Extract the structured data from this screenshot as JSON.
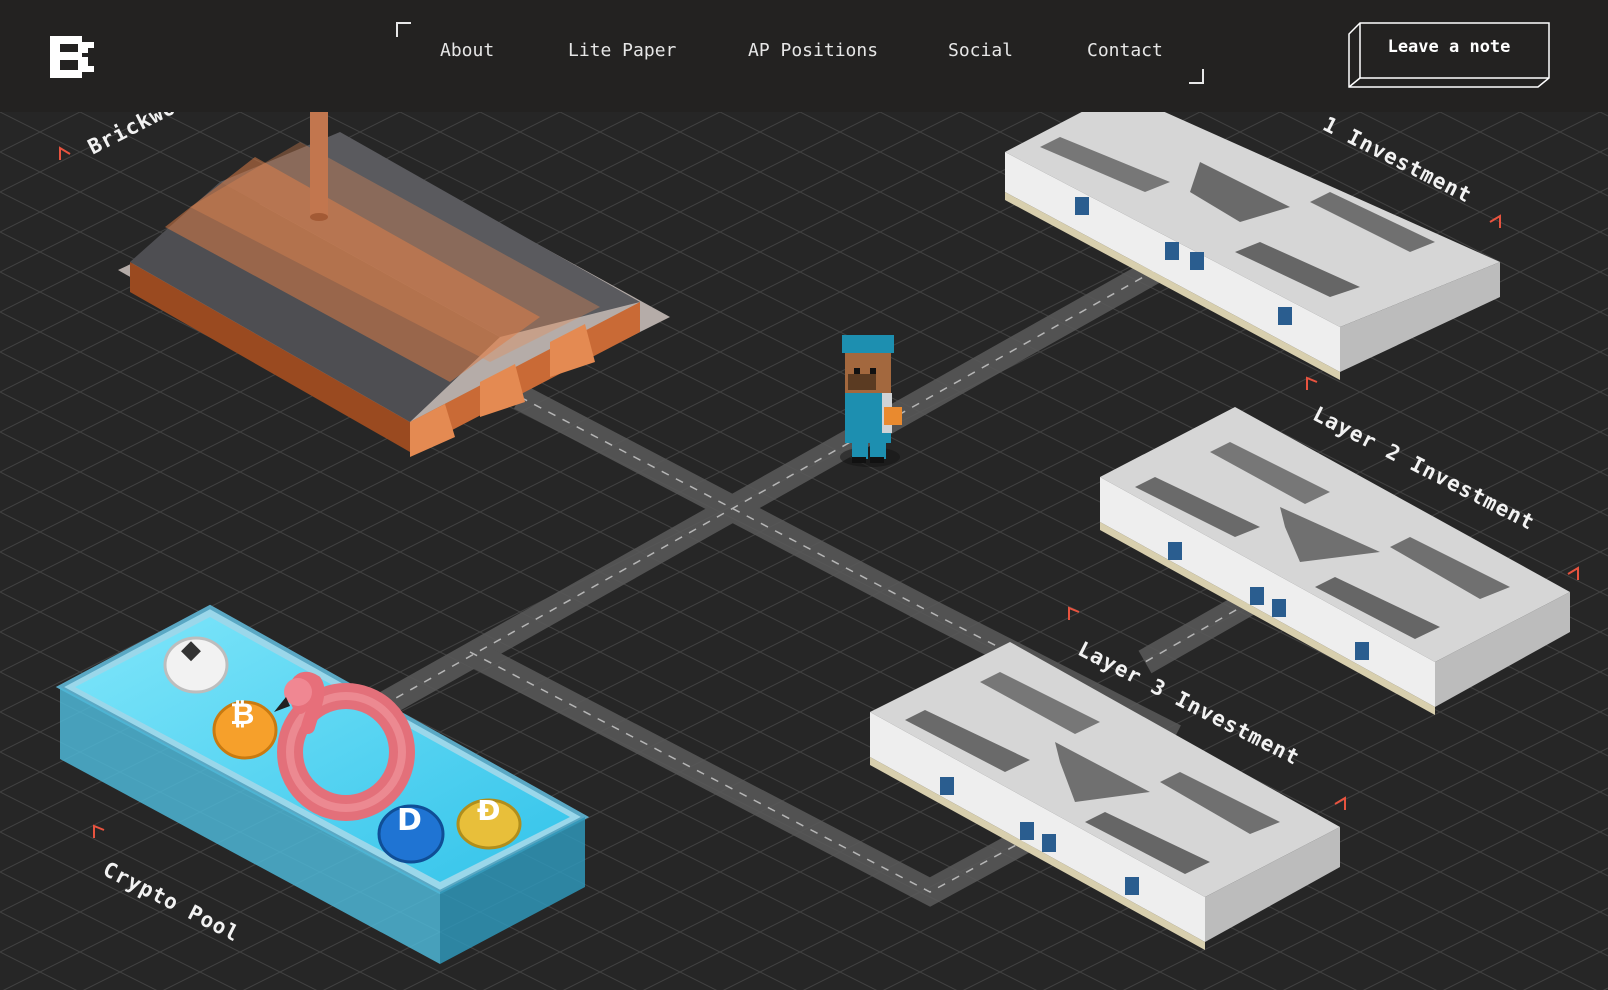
{
  "header": {
    "logo_alt": "B",
    "nav": [
      {
        "label": "About"
      },
      {
        "label": "Lite Paper"
      },
      {
        "label": "AP Positions"
      },
      {
        "label": "Social"
      },
      {
        "label": "Contact"
      }
    ],
    "cta_label": "Leave a note"
  },
  "scene": {
    "labels": {
      "brickworks": "Brickwo",
      "layer1": "1 Investment",
      "layer2": "Layer 2 Investment",
      "layer3": "Layer 3 Investment",
      "crypto_pool": "Crypto Pool"
    },
    "coins": {
      "bitcoin": "₿",
      "dash": "D",
      "doge": "Ð",
      "eth": "◆"
    }
  },
  "colors": {
    "background": "#262626",
    "header": "#232221",
    "accent_marker": "#e8533f",
    "grid": "#4a4a4a",
    "pool_water": "#4fd3f0",
    "worker_blue": "#1d8fb0"
  }
}
